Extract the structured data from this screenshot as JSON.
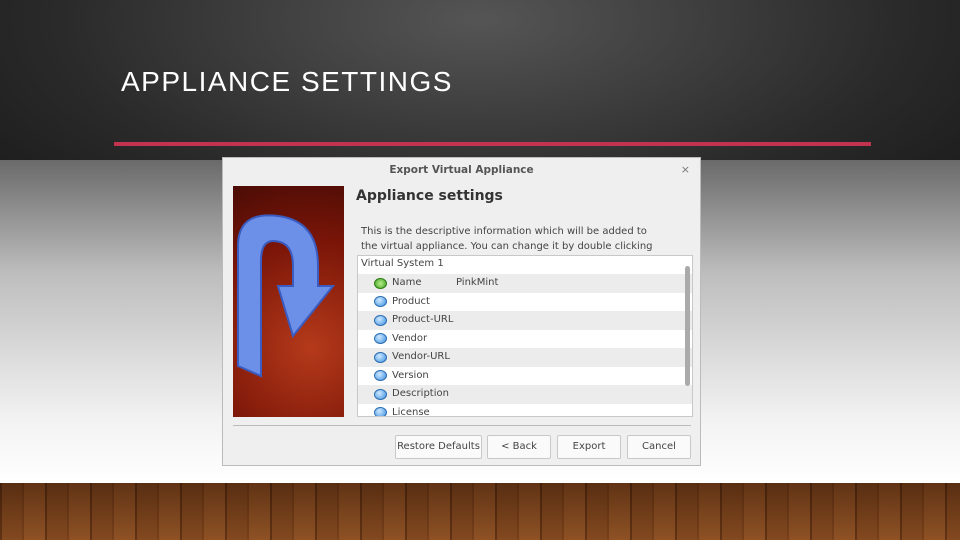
{
  "slide": {
    "title": "APPLIANCE SETTINGS"
  },
  "dialog": {
    "title": "Export Virtual Appliance",
    "heading": "Appliance settings",
    "description": "This is the descriptive information which will be added to the virtual appliance. You can change it by double clicking on individual lines.",
    "group": "Virtual System 1",
    "rows": [
      {
        "label": "Name",
        "value": "PinkMint",
        "icon": "name-icon"
      },
      {
        "label": "Product",
        "value": "",
        "icon": "description-bubble-icon"
      },
      {
        "label": "Product-URL",
        "value": "",
        "icon": "description-bubble-icon"
      },
      {
        "label": "Vendor",
        "value": "",
        "icon": "description-bubble-icon"
      },
      {
        "label": "Vendor-URL",
        "value": "",
        "icon": "description-bubble-icon"
      },
      {
        "label": "Version",
        "value": "",
        "icon": "description-bubble-icon"
      },
      {
        "label": "Description",
        "value": "",
        "icon": "description-bubble-icon"
      },
      {
        "label": "License",
        "value": "",
        "icon": "description-bubble-icon"
      }
    ],
    "buttons": {
      "restore": "Restore Defaults",
      "back": "< Back",
      "export": "Export",
      "cancel": "Cancel"
    },
    "close": "×"
  }
}
